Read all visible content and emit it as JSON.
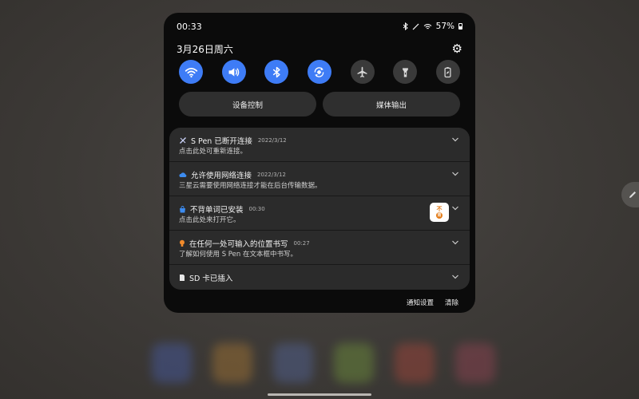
{
  "status_bar": {
    "time": "00:33",
    "battery": "57%"
  },
  "header": {
    "date": "3月26日周六",
    "settings_icon": "gear-icon"
  },
  "quick_settings": [
    {
      "name": "wifi",
      "icon": "wifi-icon",
      "state": "on"
    },
    {
      "name": "sound",
      "icon": "sound-icon",
      "state": "on"
    },
    {
      "name": "bluetooth",
      "icon": "bluetooth-icon",
      "state": "on"
    },
    {
      "name": "auto-rotate",
      "icon": "auto-rotate-icon",
      "state": "on"
    },
    {
      "name": "airplane",
      "icon": "airplane-icon",
      "state": "off"
    },
    {
      "name": "flashlight",
      "icon": "flashlight-icon",
      "state": "off"
    },
    {
      "name": "power-saving",
      "icon": "battery-saver-icon",
      "state": "off"
    }
  ],
  "buttons": {
    "device_control": "设备控制",
    "media_output": "媒体输出"
  },
  "notifications": [
    {
      "title": "S Pen 已断开连接",
      "time": "2022/3/12",
      "text": "点击此处可重新连接。",
      "icon": "spen-icon"
    },
    {
      "title": "允许使用网络连接",
      "time": "2022/3/12",
      "text": "三星云需要使用网络连接才能在后台传输数据。",
      "icon": "cloud-icon"
    },
    {
      "title": "不背单词已安装",
      "time": "00:30",
      "text": "点击此处来打开它。",
      "icon": "app-store-icon",
      "app_icon_text": "不背"
    },
    {
      "title": "在任何一处可输入的位置书写",
      "time": "00:27",
      "text": "了解如何使用 S Pen 在文本框中书写。",
      "icon": "lightbulb-icon"
    },
    {
      "title": "SD 卡已插入",
      "icon": "sd-card-icon"
    }
  ],
  "footer": {
    "notification_settings": "通知设置",
    "clear": "清除"
  },
  "colors": {
    "accent": "#3e7cf6",
    "panel": "#0b0b0b",
    "card": "#2b2b2b"
  }
}
